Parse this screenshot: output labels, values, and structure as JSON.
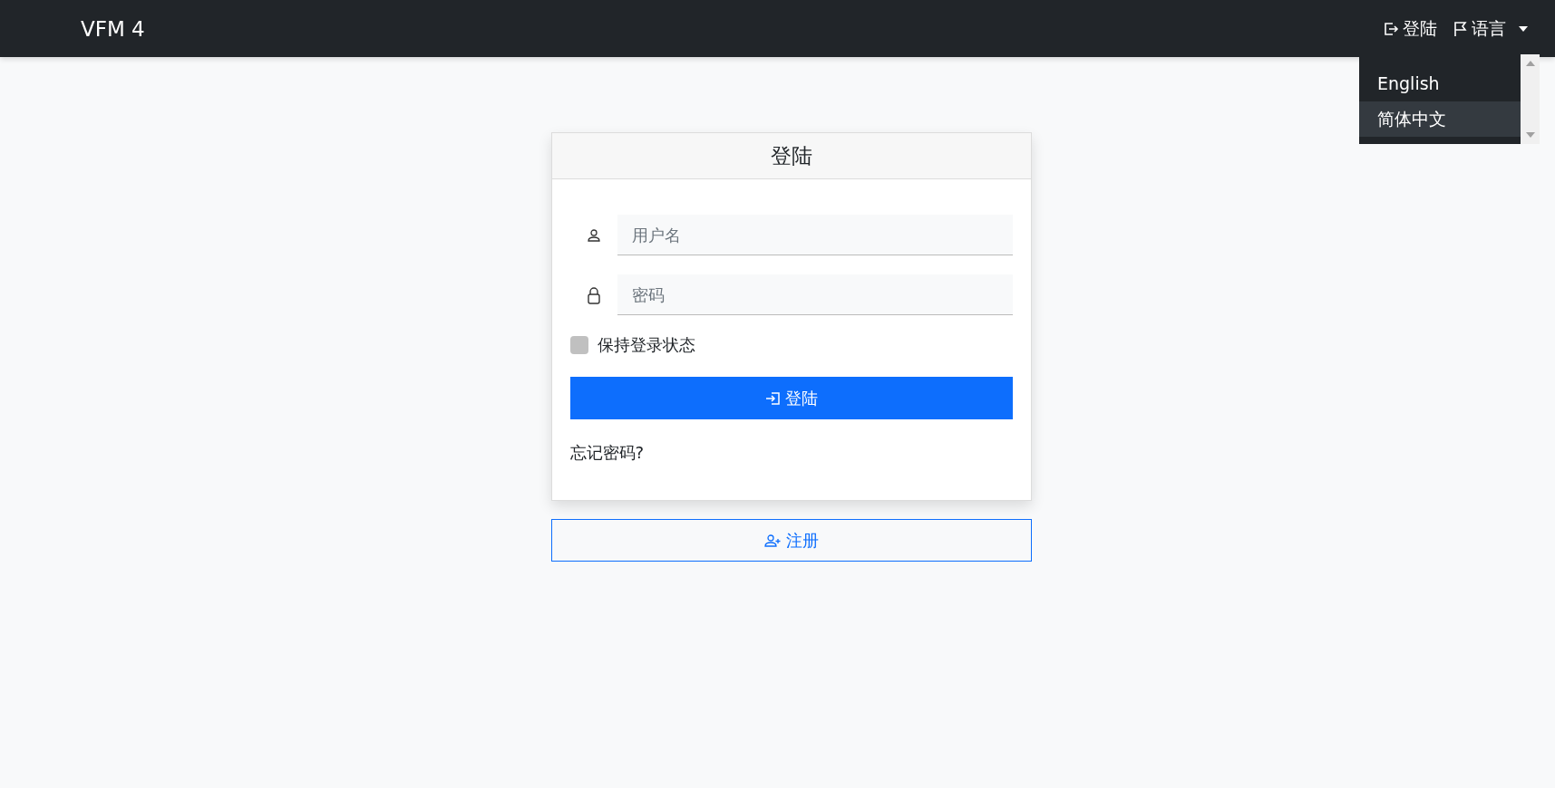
{
  "navbar": {
    "brand": "VFM 4",
    "login_link": "登陆",
    "language_menu": {
      "label": "语言",
      "expanded": true,
      "options": [
        {
          "label": "English",
          "selected": false
        },
        {
          "label": "简体中文",
          "selected": true
        }
      ]
    }
  },
  "login_card": {
    "title": "登陆",
    "username": {
      "placeholder": "用户名"
    },
    "password": {
      "placeholder": "密码"
    },
    "remember": {
      "label": "保持登录状态",
      "checked": false
    },
    "submit": "登陆",
    "forgot_link": "忘记密码?"
  },
  "register_button": "注册"
}
